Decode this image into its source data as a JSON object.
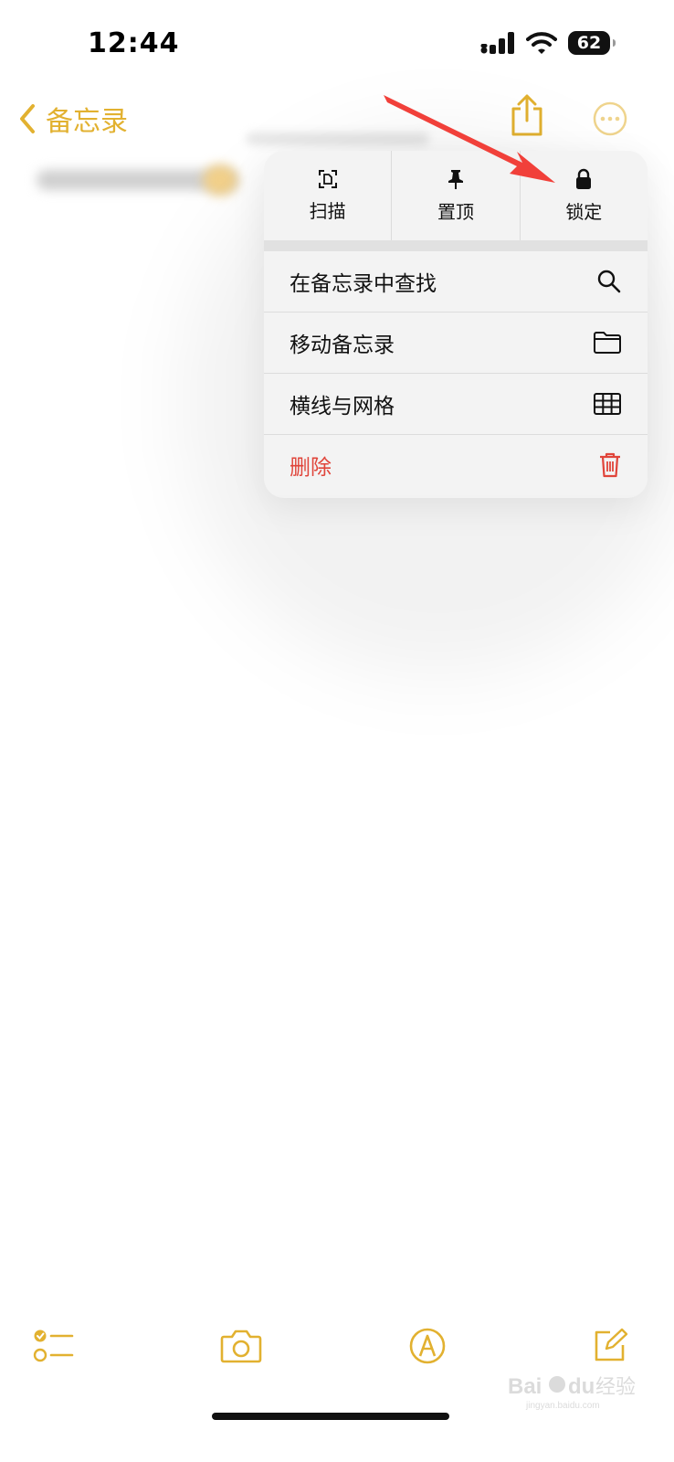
{
  "status_bar": {
    "time": "12:44",
    "battery": "62"
  },
  "nav": {
    "back_label": "备忘录"
  },
  "menu": {
    "top_actions": [
      {
        "label": "扫描",
        "icon": "scan-icon"
      },
      {
        "label": "置顶",
        "icon": "pin-icon"
      },
      {
        "label": "锁定",
        "icon": "lock-icon"
      }
    ],
    "items": [
      {
        "label": "在备忘录中查找",
        "icon": "search-icon"
      },
      {
        "label": "移动备忘录",
        "icon": "folder-icon"
      },
      {
        "label": "横线与网格",
        "icon": "grid-icon"
      },
      {
        "label": "删除",
        "icon": "trash-icon"
      }
    ]
  },
  "watermark": {
    "text": "Baidu经验",
    "subtext": "jingyan.baidu.com"
  },
  "colors": {
    "accent": "#E2B130",
    "danger": "#E0443A",
    "annotation_arrow": "#F1403A"
  }
}
